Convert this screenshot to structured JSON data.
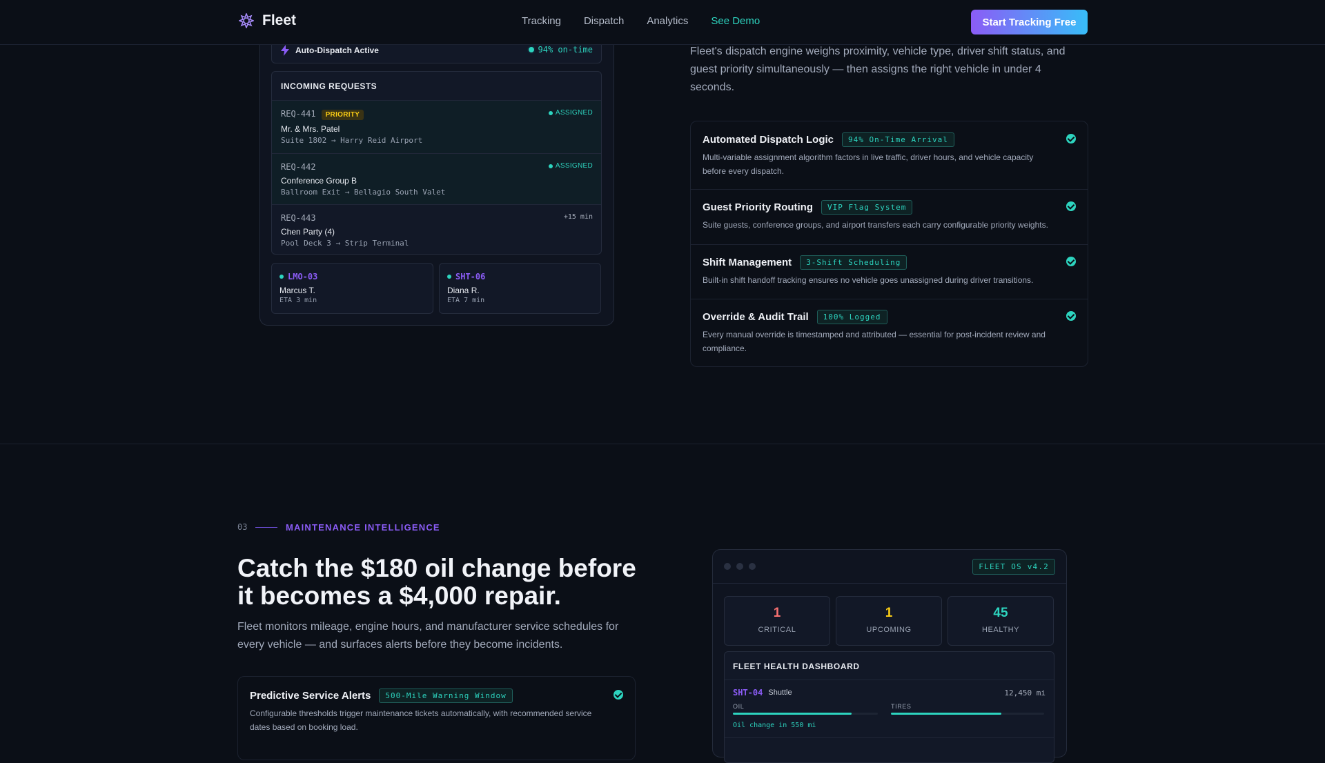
{
  "nav": {
    "brand": "Fleet",
    "links": [
      "Tracking",
      "Dispatch",
      "Analytics"
    ],
    "demo": "See Demo",
    "cta": "Start Tracking Free"
  },
  "dispatch": {
    "auto_label": "Auto-Dispatch Active",
    "ontime": "94% on-time",
    "incoming_title": "INCOMING REQUESTS",
    "requests": [
      {
        "id": "REQ-441",
        "badge": "PRIORITY",
        "name": "Mr. & Mrs. Patel",
        "route": "Suite 1802 → Harry Reid Airport",
        "status": "ASSIGNED"
      },
      {
        "id": "REQ-442",
        "name": "Conference Group B",
        "route": "Ballroom Exit → Bellagio South Valet",
        "status": "ASSIGNED"
      },
      {
        "id": "REQ-443",
        "name": "Chen Party (4)",
        "route": "Pool Deck 3 → Strip Terminal",
        "eta": "+15 min"
      }
    ],
    "vehicles": [
      {
        "id": "LMO-03",
        "driver": "Marcus T.",
        "eta": "ETA 3 min"
      },
      {
        "id": "SHT-06",
        "driver": "Diana R.",
        "eta": "ETA 7 min"
      }
    ]
  },
  "dispatch_features": {
    "intro": "Fleet's dispatch engine weighs proximity, vehicle type, driver shift status, and guest priority simultaneously — then assigns the right vehicle in under 4 seconds.",
    "items": [
      {
        "title": "Automated Dispatch Logic",
        "tag": "94% On-Time Arrival",
        "desc": "Multi-variable assignment algorithm factors in live traffic, driver hours, and vehicle capacity before every dispatch."
      },
      {
        "title": "Guest Priority Routing",
        "tag": "VIP Flag System",
        "desc": "Suite guests, conference groups, and airport transfers each carry configurable priority weights."
      },
      {
        "title": "Shift Management",
        "tag": "3-Shift Scheduling",
        "desc": "Built-in shift handoff tracking ensures no vehicle goes unassigned during driver transitions."
      },
      {
        "title": "Override & Audit Trail",
        "tag": "100% Logged",
        "desc": "Every manual override is timestamped and attributed — essential for post-incident review and compliance."
      }
    ]
  },
  "maintenance": {
    "number": "03",
    "label": "MAINTENANCE INTELLIGENCE",
    "headline": "Catch the $180 oil change before it becomes a $4,000 repair.",
    "sub": "Fleet monitors mileage, engine hours, and manufacturer service schedules for every vehicle — and surfaces alerts before they become incidents.",
    "feature": {
      "title": "Predictive Service Alerts",
      "tag": "500-Mile Warning Window",
      "desc": "Configurable thresholds trigger maintenance tickets automatically, with recommended service dates based on booking load."
    }
  },
  "fleet_os": {
    "version": "FLEET OS v4.2",
    "stats": [
      {
        "value": "1",
        "label": "CRITICAL",
        "color": "#f87171"
      },
      {
        "value": "1",
        "label": "UPCOMING",
        "color": "#facc15"
      },
      {
        "value": "45",
        "label": "HEALTHY",
        "color": "#2dd4bf"
      }
    ],
    "health_title": "FLEET HEALTH DASHBOARD",
    "vehicle": {
      "id": "SHT-04",
      "type": "Shuttle",
      "mileage": "12,450 mi",
      "oil_label": "OIL",
      "oil_pct": 0.82,
      "tires_label": "TIRES",
      "tires_pct": 0.72,
      "note": "Oil change in 550 mi"
    }
  }
}
